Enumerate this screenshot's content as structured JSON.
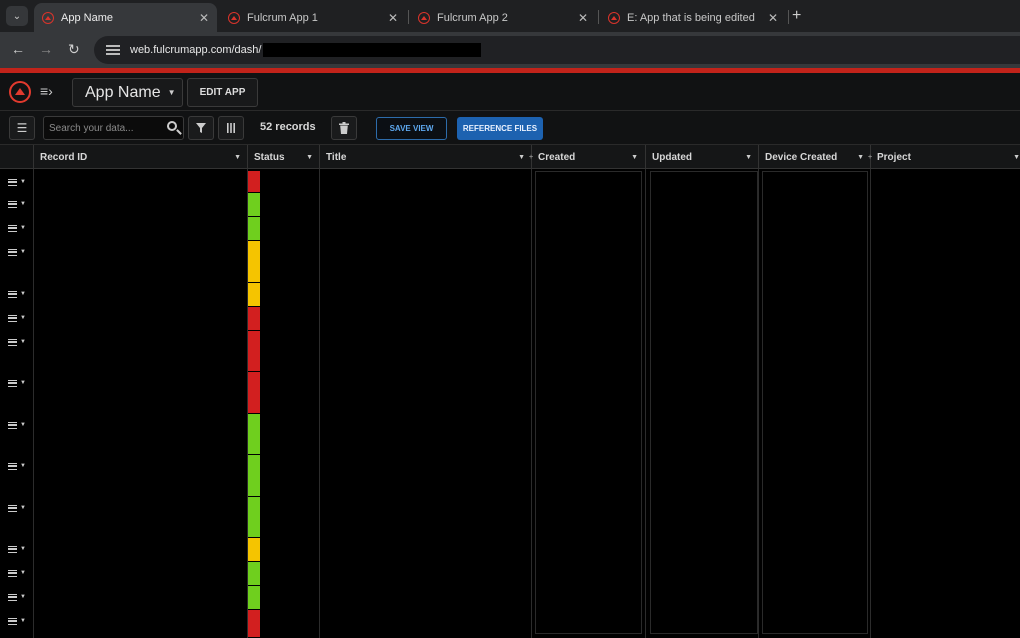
{
  "browser": {
    "tabs": [
      {
        "label": "App Name",
        "active": true
      },
      {
        "label": "Fulcrum App 1",
        "active": false
      },
      {
        "label": "Fulcrum App 2",
        "active": false
      },
      {
        "label": "E: App that is being edited",
        "active": false
      }
    ],
    "url": "web.fulcrumapp.com/dash/",
    "icons": {
      "back": "back-arrow-icon",
      "forward": "forward-arrow-icon",
      "reload": "reload-icon",
      "new_tab": "plus-icon",
      "close": "close-icon"
    }
  },
  "app": {
    "name": "App Name",
    "edit_label": "EDIT APP",
    "brand_color": "#e23a2e"
  },
  "toolbar": {
    "search_placeholder": "Search your data...",
    "record_count": "52 records",
    "save_view_label": "SAVE VIEW",
    "reference_files_label": "REFERENCE FILES"
  },
  "grid": {
    "columns": [
      "Record ID",
      "Status",
      "Title",
      "Created",
      "Updated",
      "Device Created",
      "Project"
    ],
    "status_colors": {
      "red": "#d21f1f",
      "green": "#6fcf1e",
      "yellow": "#f5c400"
    },
    "rows": [
      {
        "status": "red"
      },
      {
        "status": "green"
      },
      {
        "status": "green"
      },
      {
        "status": "yellow"
      },
      {
        "status": "yellow"
      },
      {
        "status": "red"
      },
      {
        "status": "red"
      },
      {
        "status": "red"
      },
      {
        "status": "green"
      },
      {
        "status": "green"
      },
      {
        "status": "green"
      },
      {
        "status": "yellow"
      },
      {
        "status": "green"
      },
      {
        "status": "green"
      },
      {
        "status": "red"
      }
    ]
  }
}
